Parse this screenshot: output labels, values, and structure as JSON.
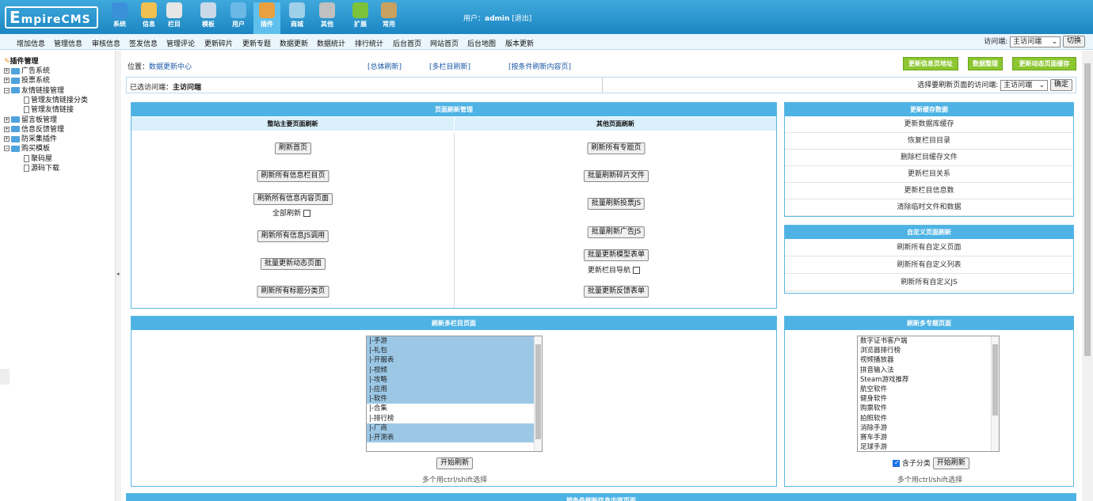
{
  "logo": {
    "first": "E",
    "rest": "mpireCMS"
  },
  "top_nav": [
    {
      "label": "系统",
      "icon": "globe-icon",
      "color": "#3b8fd8"
    },
    {
      "label": "信息",
      "icon": "pencil-doc-icon",
      "color": "#f0c050"
    },
    {
      "label": "栏目",
      "icon": "folder-icon",
      "color": "#e6e6e6"
    },
    {
      "label": "模板",
      "icon": "template-icon",
      "color": "#c9d9e8"
    },
    {
      "label": "用户",
      "icon": "user-icon",
      "color": "#69b8e6"
    },
    {
      "label": "插件",
      "icon": "tools-icon",
      "color": "#e8a040"
    },
    {
      "label": "商城",
      "icon": "shop-icon",
      "color": "#9fd0ea"
    },
    {
      "label": "其他",
      "icon": "gear-icon",
      "color": "#c0c0c0"
    },
    {
      "label": "扩展",
      "icon": "plus-icon",
      "color": "#7cc23a"
    },
    {
      "label": "常用",
      "icon": "box-icon",
      "color": "#c8a060"
    }
  ],
  "user": {
    "prefix": "用户：",
    "name": "admin",
    "logout": "[退出]"
  },
  "menubar": [
    "增加信息",
    "管理信息",
    "审核信息",
    "签发信息",
    "管理评论",
    "更新碎片",
    "更新专题",
    "数据更新",
    "数据统计",
    "排行统计",
    "后台首页",
    "网站首页",
    "后台地图",
    "版本更新"
  ],
  "switch": {
    "label": "访问端:",
    "selected": "主访问端",
    "button": "切换"
  },
  "sidebar": {
    "root": "插件管理",
    "items": [
      {
        "label": "广告系统",
        "level": 1
      },
      {
        "label": "投票系统",
        "level": 1
      },
      {
        "label": "友情链接管理",
        "level": 1
      },
      {
        "label": "管理友情链接分类",
        "level": 2
      },
      {
        "label": "管理友情链接",
        "level": 2
      },
      {
        "label": "留言板管理",
        "level": 1
      },
      {
        "label": "信息反馈管理",
        "level": 1
      },
      {
        "label": "防采集插件",
        "level": 1
      },
      {
        "label": "购买模板",
        "level": 1
      },
      {
        "label": "聚码屋",
        "level": 2
      },
      {
        "label": "源码下载",
        "level": 2
      }
    ]
  },
  "location": {
    "label": "位置：",
    "link": "数据更新中心"
  },
  "top_links": [
    "[总体刷新]",
    "[多栏目刷新]",
    "[按条件刷新内容页]"
  ],
  "green_buttons": [
    "更新信息页地址",
    "数据整理",
    "更新动态页面缓存"
  ],
  "access_bar": {
    "selected_label": "已选访问端：",
    "selected_value": "主访问端",
    "choose_label": "选择要刷新页面的访问端:",
    "choose_value": "主访问端",
    "confirm": "确定"
  },
  "page_refresh": {
    "title": "页面刷新管理",
    "left_head": "整站主要页面刷新",
    "right_head": "其他页面刷新",
    "left_buttons": [
      "刷新首页",
      "刷新所有信息栏目页",
      "刷新所有信息内容页面",
      "刷新所有信息JS调用",
      "批量更新动态页面",
      "刷新所有标题分类页"
    ],
    "all_refresh": "全部刷新",
    "right_buttons": [
      "刷新所有专题页",
      "批量刷新碎片文件",
      "批量刷新投票JS",
      "批量刷新广告JS",
      "批量更新模型表单",
      "批量更新反馈表单"
    ],
    "nav_update": "更新栏目导航"
  },
  "cache_panel": {
    "title": "更新缓存数据",
    "items": [
      "更新数据库缓存",
      "恢复栏目目录",
      "删除栏目缓存文件",
      "更新栏目关系",
      "更新栏目信息数",
      "清除临时文件和数据"
    ]
  },
  "custom_panel": {
    "title": "自定义页面刷新",
    "items": [
      "刷新所有自定义页面",
      "刷新所有自定义列表",
      "刷新所有自定义JS"
    ]
  },
  "multi_column": {
    "title": "刷新多栏目页面",
    "options": [
      {
        "label": "|-手游",
        "selected": true
      },
      {
        "label": "|-礼包",
        "selected": true
      },
      {
        "label": "|-开服表",
        "selected": true
      },
      {
        "label": "|-视频",
        "selected": true
      },
      {
        "label": "|-攻略",
        "selected": true
      },
      {
        "label": "|-应用",
        "selected": true
      },
      {
        "label": "|-软件",
        "selected": true
      },
      {
        "label": "|-合集",
        "selected": false
      },
      {
        "label": "|-排行榜",
        "selected": false
      },
      {
        "label": "|-厂商",
        "selected": true
      },
      {
        "label": "|-开测表",
        "selected": true
      }
    ],
    "start": "开始刷新",
    "hint": "多个用ctrl/shift选择"
  },
  "multi_topic": {
    "title": "刷新多专题页面",
    "options": [
      "数字证书客户端",
      "浏览器排行榜",
      "视频播放器",
      "拼音输入法",
      "Steam游戏推荐",
      "航空软件",
      "健身软件",
      "购票软件",
      "拍照软件",
      "消除手游",
      "赛车手游",
      "足球手游"
    ],
    "include_child": "含子分类",
    "start": "开始刷新",
    "hint": "多个用ctrl/shift选择"
  },
  "bottom_panel": {
    "title": "按条件刷新信息内容页面"
  }
}
